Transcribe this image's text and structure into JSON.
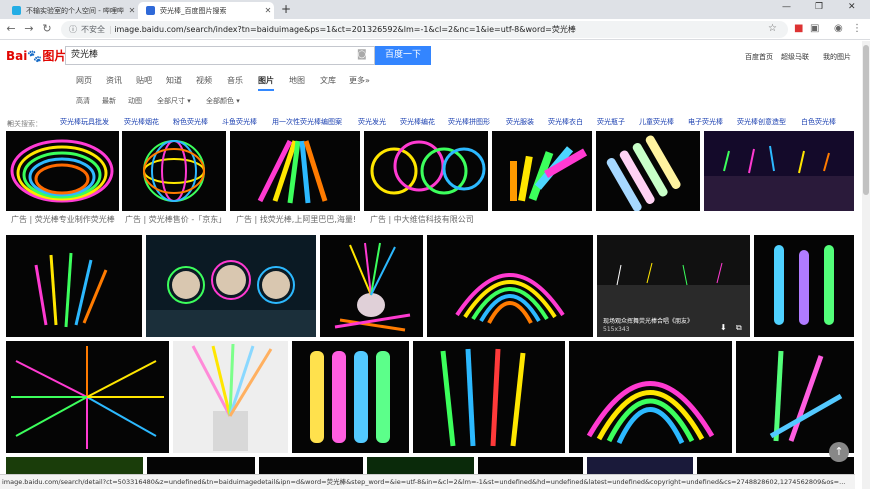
{
  "tabs": [
    {
      "label": "不输实验室的个人空间 - 哔哩哔",
      "icon": "bilibili-icon"
    },
    {
      "label": "荧光棒_百度图片搜索",
      "icon": "baidu-paw-icon"
    }
  ],
  "address": {
    "security": "不安全",
    "url": "image.baidu.com/search/index?tn=baiduimage&ps=1&ct=201326592&lm=-1&cl=2&nc=1&ie=utf-8&word=荧光棒"
  },
  "header": {
    "logo_text": "Bai",
    "logo_du": "du",
    "logo_img": "图片",
    "search_value": "荧光棒",
    "search_button": "百度一下",
    "links": [
      "百度首页",
      "超级马联",
      "我的图片"
    ]
  },
  "nav": {
    "items": [
      "网页",
      "资讯",
      "贴吧",
      "知道",
      "视频",
      "音乐",
      "图片",
      "地图",
      "文库",
      "更多»"
    ],
    "active": "图片"
  },
  "filters": [
    "高清",
    "最新",
    "动图",
    "全部尺寸 ▾",
    "全部颜色 ▾"
  ],
  "related": {
    "label": "相关搜索：",
    "items": [
      "荧光棒玩具批发",
      "荧光棒烟花",
      "粉色荧光棒",
      "斗鱼荧光棒",
      "用一次性荧光棒编图案",
      "荧光发光",
      "荧光棒编花",
      "荧光棒拼图形",
      "荧光服装",
      "荧光棒衣白",
      "荧光瓶子",
      "儿童荧光棒",
      "电子荧光棒",
      "荧光棒创意造型",
      "白色荧光棒"
    ]
  },
  "ads": [
    "广告 | 荧光棒专业制作荧光棒",
    "广告 | 荧光棒售价 -「京东」",
    "广告 | 找荧光棒,上阿里巴巴,海量!",
    "广告 | 中大维信科技有限公司"
  ],
  "hover": {
    "title": "现场观众挥舞荧光棒合唱《朋友》",
    "size": "515x343"
  },
  "status_url": "image.baidu.com/search/detail?ct=503316480&z=undefined&tn=baiduimagedetail&ipn=d&word=荧光棒&step_word=&ie=utf-8&in=&cl=2&lm=-1&st=undefined&hd=undefined&latest=undefined&copyright=undefined&cs=2748828602,1274562809&os=...",
  "colors": {
    "accent": "#3385ff",
    "link": "#1a3fb0",
    "tab_bg": "#dee1e6"
  }
}
